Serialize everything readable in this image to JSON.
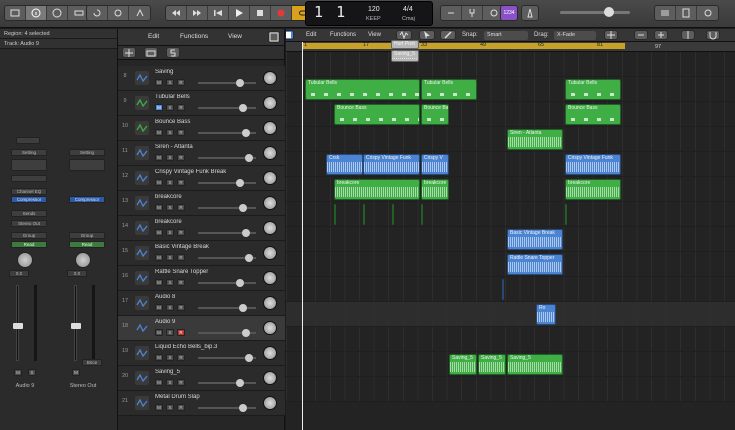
{
  "lcd": {
    "bar": "1",
    "beat": "1",
    "tempo": "120",
    "tempo_label": "KEEP",
    "signature": "4/4",
    "key": "Cmaj"
  },
  "control_bar": {
    "count_in_label": "1234"
  },
  "inspector": {
    "region": "Region: 4 selected",
    "track": "Track: Audio 9",
    "strip1": {
      "setting": "Setting",
      "eq": "Channel EQ",
      "plugin": "Compressor",
      "sends": "Sends",
      "output": "Stereo Out",
      "group": "Group",
      "auto": "Read",
      "value": "0.0",
      "name": "Audio 9",
      "ms": [
        "M",
        "S"
      ]
    },
    "strip2": {
      "setting": "Setting",
      "plugin": "Compressor",
      "group": "Group",
      "auto": "Read",
      "value": "0.0",
      "name": "Stereo Out",
      "bnce": "Bnce",
      "ms": [
        "M"
      ]
    }
  },
  "track_menu": {
    "edit": "Edit",
    "functions": "Functions",
    "view": "View"
  },
  "arrange_menu": {
    "edit": "Edit",
    "functions": "Functions",
    "view": "View",
    "snap": "Snap:",
    "snap_value": "Smart",
    "drag": "Drag:",
    "drag_value": "X-Fade"
  },
  "ruler": {
    "marks": [
      "1",
      "17",
      "33",
      "49",
      "65",
      "81",
      "97"
    ]
  },
  "tracks": [
    {
      "num": "8",
      "name": "Saving",
      "type": "audio"
    },
    {
      "num": "9",
      "name": "Tubular Bells",
      "type": "instrument"
    },
    {
      "num": "10",
      "name": "Bounce Bass",
      "type": "instrument"
    },
    {
      "num": "11",
      "name": "Siren - Atlanta",
      "type": "audio"
    },
    {
      "num": "12",
      "name": "Crispy Vintage Funk Break",
      "type": "audio"
    },
    {
      "num": "13",
      "name": "breakcore",
      "type": "audio"
    },
    {
      "num": "14",
      "name": "breakcore",
      "type": "audio"
    },
    {
      "num": "15",
      "name": "Basic Vintage Break",
      "type": "audio"
    },
    {
      "num": "16",
      "name": "Rattle Snare Topper",
      "type": "audio"
    },
    {
      "num": "17",
      "name": "Audio 8",
      "type": "audio"
    },
    {
      "num": "18",
      "name": "Audio 9",
      "type": "audio"
    },
    {
      "num": "19",
      "name": "Liquid Echo Bells_bip.3",
      "type": "audio"
    },
    {
      "num": "20",
      "name": "Saving_5",
      "type": "audio"
    },
    {
      "num": "21",
      "name": "Metal Drum Slap",
      "type": "audio"
    }
  ],
  "regions": {
    "saving_top": "Hurt Post",
    "saving_gray": "Saving_5",
    "tub1": "Tubular Bells",
    "tub2": "Tubular Bells",
    "tub3": "Tubular Bells",
    "bass1": "Bounce Bass",
    "bass2": "Bounce Bass",
    "bass3": "Bounce Bass",
    "siren": "Siren - Atlanta",
    "crispy1": "Crsk",
    "crispy2": "Crispy Vintage Funk",
    "crispy3": "Crispy V",
    "crispy4": "Crispy Vintage Funk",
    "brk1": "breakcore",
    "brk2": "breakcore",
    "brk3": "breakcore",
    "basic": "Basic Vintage Break",
    "rattle": "Rattle Snare Topper",
    "audio9": "Ro",
    "sav1": "Saving_5",
    "sav2": "Saving_5",
    "sav3": "Saving_5"
  }
}
